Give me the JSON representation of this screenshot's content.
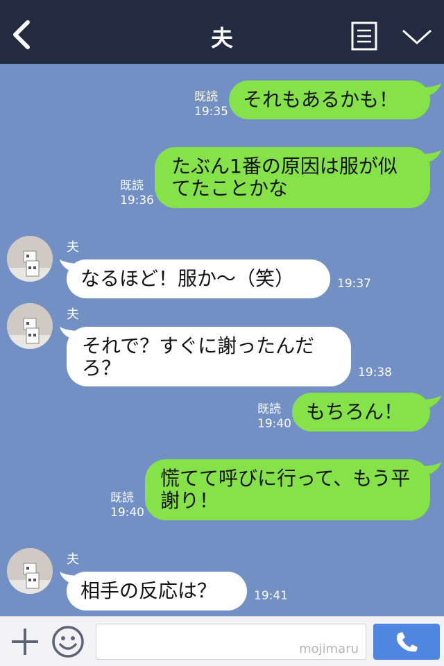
{
  "header": {
    "title": "夫"
  },
  "messages": [
    {
      "side": "me",
      "text": "それもあるかも！",
      "read": "既読",
      "time": "19:35"
    },
    {
      "side": "me",
      "text": "たぶん1番の原因は服が似てたことかな",
      "read": "既読",
      "time": "19:36"
    },
    {
      "side": "them",
      "sender": "夫",
      "text": "なるほど！服か〜（笑）",
      "time": "19:37"
    },
    {
      "side": "them",
      "sender": "夫",
      "text": "それで？すぐに謝ったんだろ？",
      "time": "19:38"
    },
    {
      "side": "me",
      "text": "もちろん！",
      "read": "既読",
      "time": "19:40"
    },
    {
      "side": "me",
      "text": "慌てて呼びに行って、もう平謝り！",
      "read": "既読",
      "time": "19:40"
    },
    {
      "side": "them",
      "sender": "夫",
      "text": "相手の反応は？",
      "time": "19:41"
    }
  ],
  "input": {
    "watermark": "mojimaru"
  },
  "colors": {
    "header_bg": "#232b40",
    "chat_bg": "#7390c4",
    "my_bubble": "#85e249",
    "their_bubble": "#ffffff",
    "send_button": "#4f86e2"
  },
  "icons": [
    "back-icon",
    "notes-icon",
    "chevron-down-icon",
    "plus-icon",
    "emoji-icon",
    "phone-icon"
  ]
}
